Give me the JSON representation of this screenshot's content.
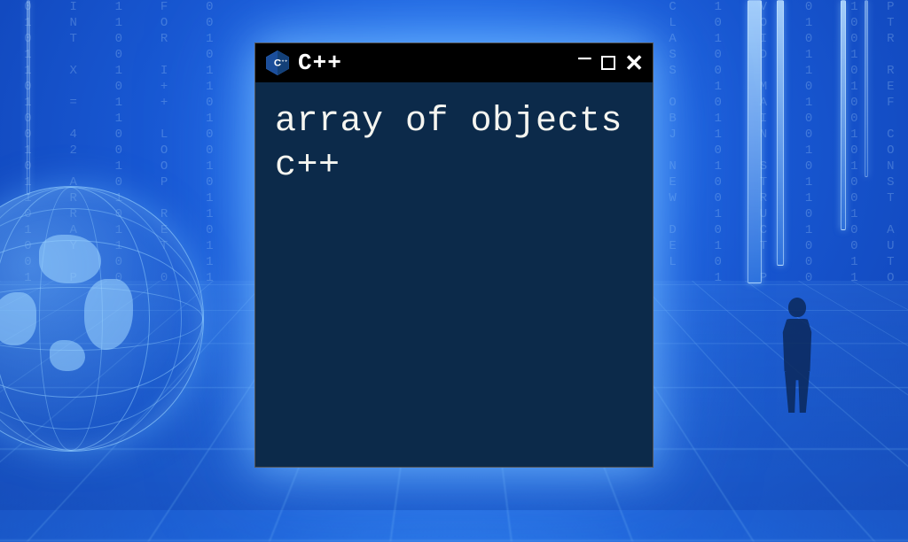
{
  "window": {
    "title": "C++",
    "content": "array of objects c++"
  },
  "icons": {
    "logo": "cpp-logo",
    "minimize": "−",
    "maximize": "□",
    "close": "✕"
  }
}
